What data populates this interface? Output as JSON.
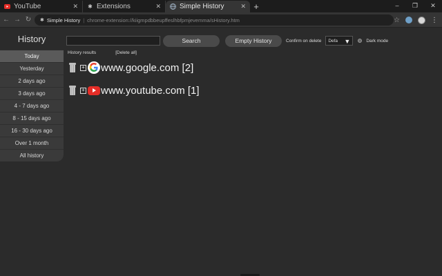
{
  "tabs": [
    {
      "title": "YouTube",
      "icon": "youtube-icon",
      "active": false
    },
    {
      "title": "Extensions",
      "icon": "puzzle-icon",
      "active": false
    },
    {
      "title": "Simple History",
      "icon": "globe-icon",
      "active": true
    }
  ],
  "address_bar": {
    "site": "Simple History",
    "url": "chrome-extension://kiigmpdbbeupffeslhbfpmjevemma/sHistory.htm"
  },
  "sidebar": {
    "title": "History",
    "items": [
      {
        "label": "Today",
        "active": true
      },
      {
        "label": "Yesterday",
        "active": false
      },
      {
        "label": "2 days ago",
        "active": false
      },
      {
        "label": "3 days ago",
        "active": false
      },
      {
        "label": "4 - 7 days ago",
        "active": false
      },
      {
        "label": "8 - 15 days ago",
        "active": false
      },
      {
        "label": "16 - 30 days ago",
        "active": false
      },
      {
        "label": "Over 1 month",
        "active": false
      },
      {
        "label": "All history",
        "active": false
      }
    ]
  },
  "toolbar": {
    "search_value": "",
    "search_label": "Search",
    "empty_label": "Empty History",
    "confirm_label": "Confirm on delete",
    "confirm_value": "Defa",
    "dark_mode_label": "Dark mode"
  },
  "results": {
    "header": "History results",
    "delete_all": "[Delete all]",
    "rows": [
      {
        "label": "www.google.com [2]",
        "icon": "google-icon"
      },
      {
        "label": "www.youtube.com [1]",
        "icon": "youtube-icon"
      }
    ]
  },
  "colors": {
    "background": "#2b2b2b",
    "sidebar_item": "#3a3a3a",
    "sidebar_active": "#5a5a5a",
    "youtube_red": "#e52d27"
  }
}
